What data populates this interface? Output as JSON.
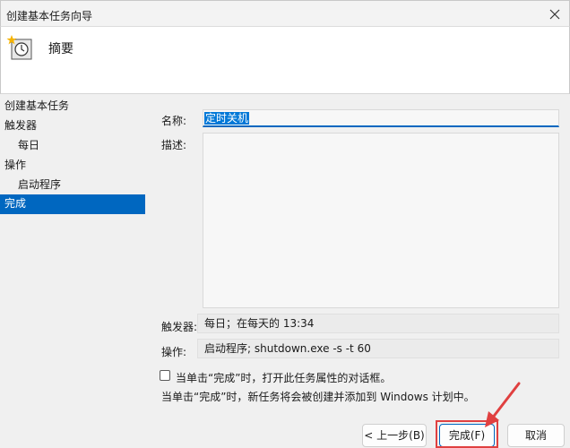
{
  "window": {
    "title": "创建基本任务向导"
  },
  "header": {
    "title": "摘要"
  },
  "sidebar": {
    "items": [
      {
        "label": "创建基本任务"
      },
      {
        "label": "触发器"
      },
      {
        "label": "每日"
      },
      {
        "label": "操作"
      },
      {
        "label": "启动程序"
      },
      {
        "label": "完成",
        "active": true
      }
    ]
  },
  "form": {
    "name_label": "名称:",
    "name_value": "定时关机",
    "desc_label": "描述:",
    "desc_value": "",
    "trigger_label": "触发器:",
    "trigger_value": "每日；在每天的 13:34",
    "action_label": "操作:",
    "action_value": "启动程序; shutdown.exe -s -t 60",
    "checkbox_label": "当单击“完成”时，打开此任务属性的对话框。",
    "checkbox_checked": false,
    "note": "当单击“完成”时，新任务将会被创建并添加到 Windows 计划中。"
  },
  "buttons": {
    "back": "< 上一步(B)",
    "finish": "完成(F)",
    "cancel": "取消"
  },
  "colors": {
    "accent": "#0067c0",
    "highlight": "#e04040"
  }
}
